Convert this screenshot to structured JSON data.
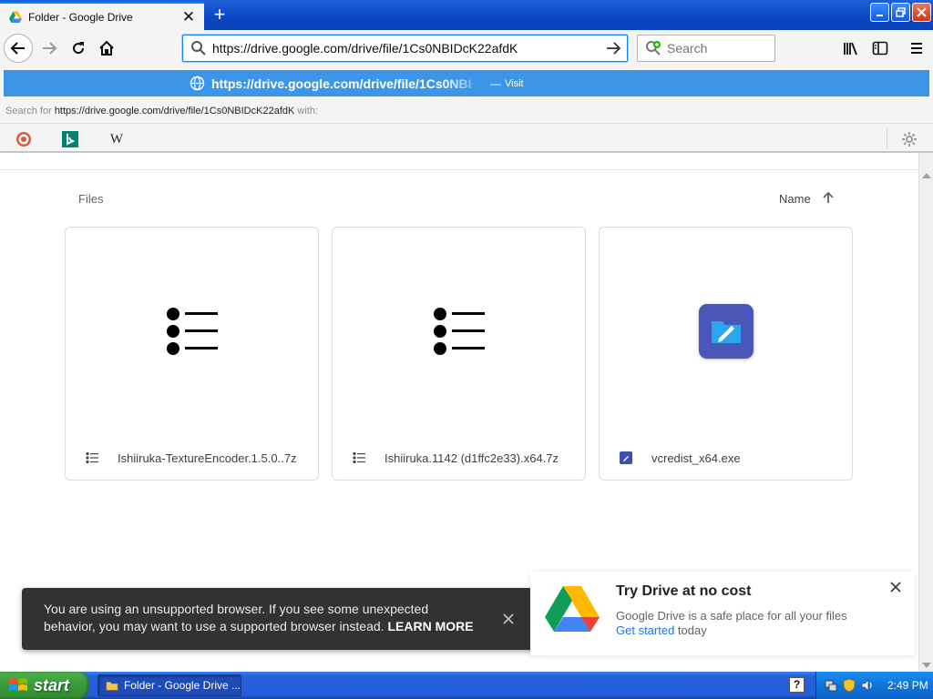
{
  "browser": {
    "tab_title": "Folder - Google Drive",
    "tab_close": "✕",
    "new_tab": "+",
    "url": "https://drive.google.com/drive/file/1Cs0NBIDcK22afdK",
    "search_placeholder": "Search",
    "visit_url": "https://drive.google.com/drive/file/1Cs0NBI",
    "visit_dash": "—",
    "visit_label": "Visit",
    "search_for_prefix": "Search for ",
    "search_for_query": "https://drive.google.com/drive/file/1Cs0NBIDcK22afdK",
    "search_for_suffix": " with:",
    "engines": {
      "wiki": "W"
    }
  },
  "drive": {
    "files_label": "Files",
    "sort_label": "Name",
    "files": [
      {
        "name": "Ishiiruka-TextureEncoder.1.5.0..7z",
        "type": "archive"
      },
      {
        "name": "Ishiiruka.1142 (d1ffc2e33).x64.7z",
        "type": "archive"
      },
      {
        "name": "vcredist_x64.exe",
        "type": "exe"
      }
    ]
  },
  "toast": {
    "message": "You are using an unsupported browser. If you see some unexpected behavior, you may want to use a supported browser instead.",
    "learn_more": "LEARN MORE"
  },
  "promo": {
    "title": "Try Drive at no cost",
    "description": "Google Drive is a safe place for all your files",
    "link": "Get started",
    "link_suffix": " today"
  },
  "taskbar": {
    "start_label": "start",
    "task_label": "Folder - Google Drive ...",
    "help": "?",
    "clock": "2:49 PM"
  },
  "colors": {
    "accent": "#0a84ff",
    "visit_row": "#3c95e6",
    "drive_blue": "#1a73e8"
  }
}
